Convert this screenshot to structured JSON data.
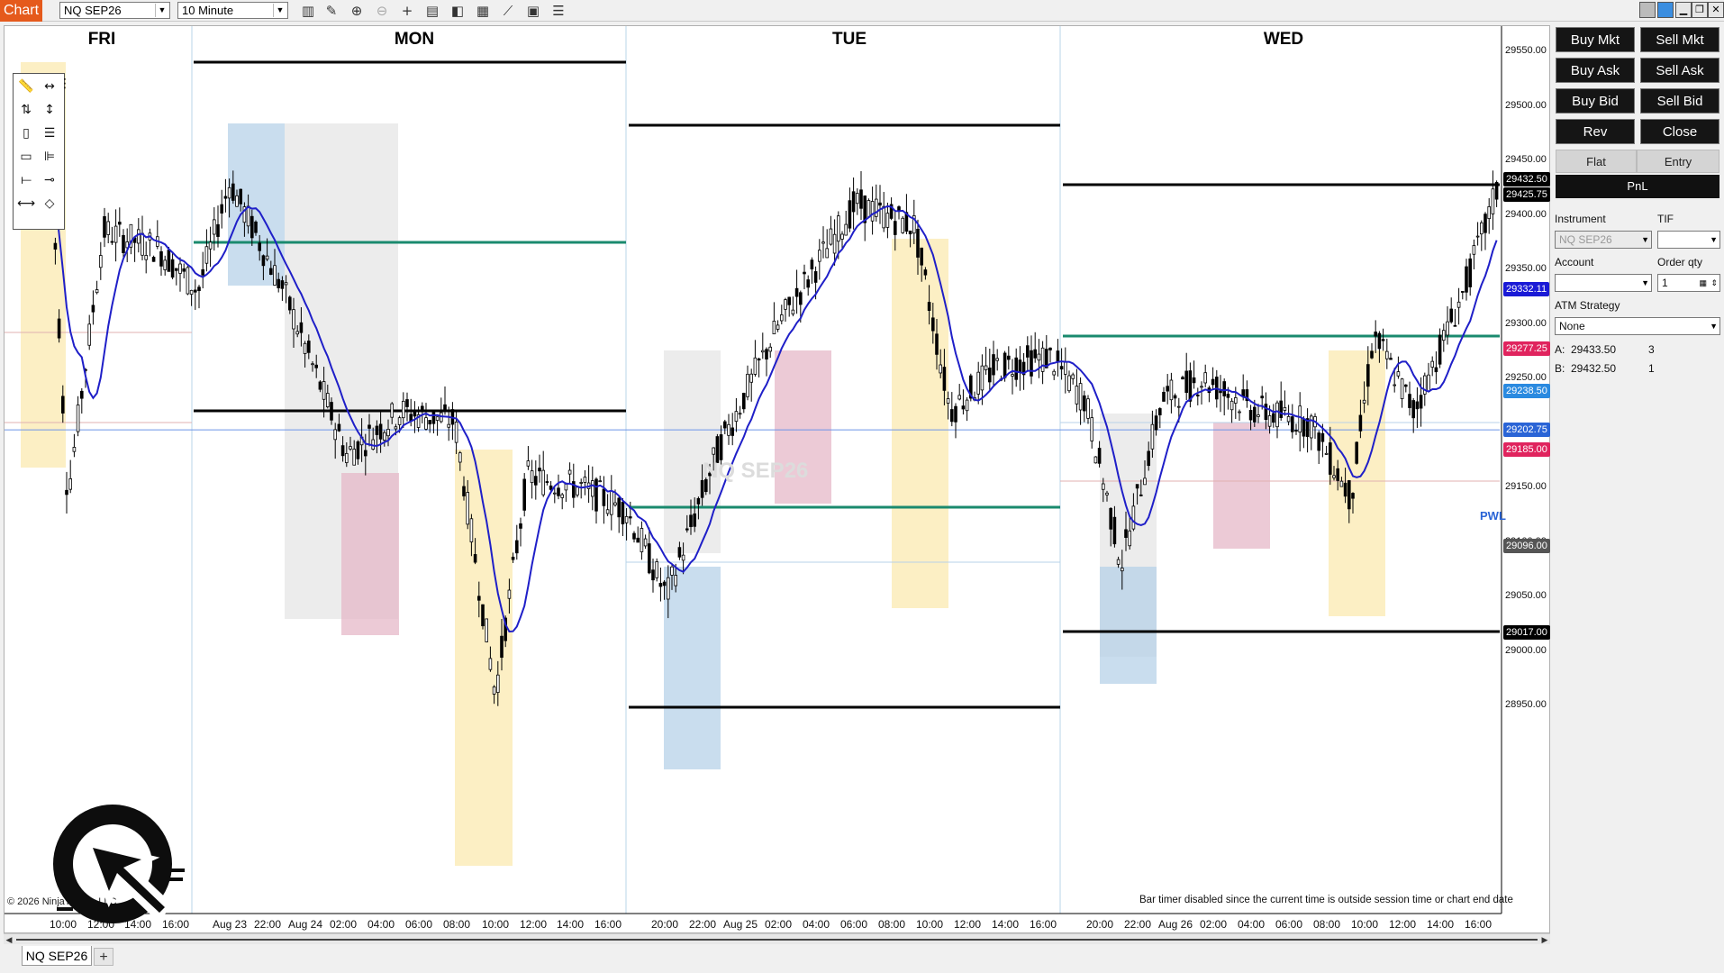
{
  "app": {
    "title": "Chart"
  },
  "toolbar": {
    "instrument": "NQ SEP26",
    "interval": "10 Minute",
    "tools": [
      "bar-type-icon",
      "draw-pencil-icon",
      "zoom-in-icon",
      "zoom-out-icon",
      "crosshair-icon",
      "data-box-icon",
      "properties-icon",
      "templates-icon",
      "strategies-icon",
      "calculator-icon",
      "indicators-list-icon"
    ]
  },
  "chart": {
    "day_labels": [
      "FRI",
      "MON",
      "TUE",
      "WED"
    ],
    "x_ticks": [
      "10:00",
      "12:00",
      "14:00",
      "16:00",
      "Aug 23",
      "22:00",
      "Aug 24",
      "02:00",
      "04:00",
      "06:00",
      "08:00",
      "10:00",
      "12:00",
      "14:00",
      "16:00",
      "20:00",
      "22:00",
      "Aug 25",
      "02:00",
      "04:00",
      "06:00",
      "08:00",
      "10:00",
      "12:00",
      "14:00",
      "16:00",
      "20:00",
      "22:00",
      "Aug 26",
      "02:00",
      "04:00",
      "06:00",
      "08:00",
      "10:00",
      "12:00",
      "14:00",
      "16:00"
    ],
    "y_ticks": [
      "29550.00",
      "29500.00",
      "29450.00",
      "29400.00",
      "29350.00",
      "29300.00",
      "29250.00",
      "29200.00",
      "29150.00",
      "29100.00",
      "29050.00",
      "29000.00",
      "28950.00"
    ],
    "price_markers": [
      {
        "value": "29432.50",
        "color": "#000000"
      },
      {
        "value": "29425.75",
        "color": "#000000"
      },
      {
        "value": "29332.11",
        "color": "#1a1ad6"
      },
      {
        "value": "29277.25",
        "color": "#e0245e"
      },
      {
        "value": "29238.50",
        "color": "#2a8ae0"
      },
      {
        "value": "29202.75",
        "color": "#2a64d6"
      },
      {
        "value": "29185.00",
        "color": "#e0245e"
      },
      {
        "value": "29096.00",
        "color": "#555555"
      },
      {
        "value": "29017.00",
        "color": "#000000"
      }
    ],
    "pwl_label": "PWL",
    "watermark": "NQ SEP26",
    "copyright": "© 2026 NinjaTrader, LLC",
    "bar_timer": "Bar timer disabled since the current time is outside session time or chart end date"
  },
  "tabs": {
    "active": "NQ SEP26",
    "add": "+"
  },
  "panel": {
    "buy_mkt": "Buy Mkt",
    "sell_mkt": "Sell Mkt",
    "buy_ask": "Buy Ask",
    "sell_ask": "Sell Ask",
    "buy_bid": "Buy Bid",
    "sell_bid": "Sell Bid",
    "rev": "Rev",
    "close": "Close",
    "flat": "Flat",
    "entry": "Entry",
    "pnl": "PnL",
    "instrument_label": "Instrument",
    "instrument_value": "NQ SEP26",
    "tif_label": "TIF",
    "tif_value": "",
    "account_label": "Account",
    "account_value": "",
    "order_qty_label": "Order qty",
    "order_qty_value": "1",
    "atm_label": "ATM Strategy",
    "atm_value": "None",
    "ask_label": "A:",
    "ask_price": "29433.50",
    "ask_size": "3",
    "bid_label": "B:",
    "bid_price": "29432.50",
    "bid_size": "1"
  },
  "colors": {
    "accent": "#e55a1c",
    "sma": "#1f1fc8",
    "teal_level": "#1a8a6e",
    "candle_body": "#000000"
  }
}
